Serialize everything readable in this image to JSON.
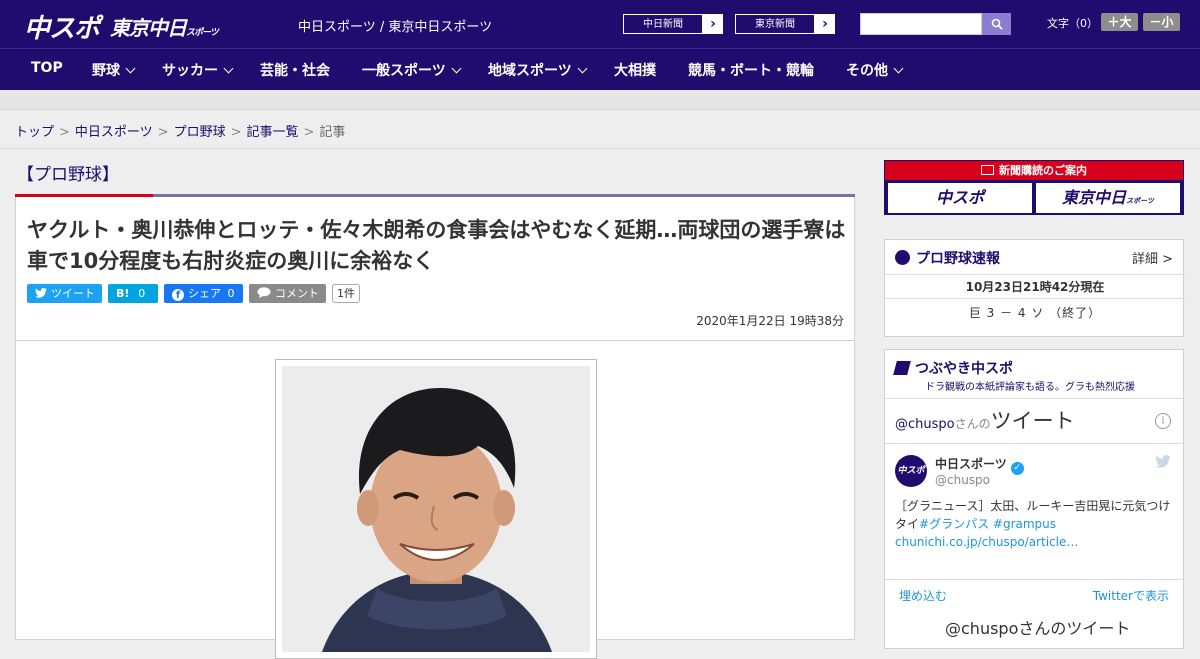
{
  "header": {
    "logo_chuspo": "中スポ",
    "logo_tokyo": "東京中日",
    "logo_tokyo_small": "スポーツ",
    "site_name": "中日スポーツ / 東京中日スポーツ",
    "paper_buttons": [
      "中日新聞",
      "東京新聞"
    ],
    "search": {
      "placeholder": ""
    },
    "font_size_label": "文字（0）",
    "font_plus": "＋大",
    "font_minus": "－小"
  },
  "nav": {
    "items": [
      {
        "label": "TOP",
        "has_dropdown": false
      },
      {
        "label": "野球",
        "has_dropdown": true
      },
      {
        "label": "サッカー",
        "has_dropdown": true
      },
      {
        "label": "芸能・社会",
        "has_dropdown": false
      },
      {
        "label": "一般スポーツ",
        "has_dropdown": true
      },
      {
        "label": "地域スポーツ",
        "has_dropdown": true
      },
      {
        "label": "大相撲",
        "has_dropdown": false
      },
      {
        "label": "競馬・ボート・競輪",
        "has_dropdown": false
      },
      {
        "label": "その他",
        "has_dropdown": true
      }
    ]
  },
  "breadcrumb": {
    "items": [
      "トップ",
      "中日スポーツ",
      "プロ野球",
      "記事一覧"
    ],
    "current": "記事",
    "separator": ">"
  },
  "article": {
    "category": "【プロ野球】",
    "headline": "ヤクルト・奥川恭伸とロッテ・佐々木朗希の食事会はやむなく延期…両球団の選手寮は車で10分程度も右肘炎症の奥川に余裕なく",
    "share": {
      "tweet": "ツイート",
      "hatena_icon": "B!",
      "hatena_count": "0",
      "facebook": "シェア",
      "facebook_count": "0",
      "comment": "コメント",
      "comment_count": "1件"
    },
    "date": "2020年1月22日 19時38分"
  },
  "sidebar": {
    "subscribe": {
      "title": "新聞購読のご案内",
      "papers": [
        "中スポ",
        "東京中日"
      ],
      "tokyo_small": "スポーツ"
    },
    "baseball": {
      "title": "プロ野球速報",
      "detail": "詳細 >",
      "updated": "10月23日21時42分現在",
      "score": "巨 3 － 4 ソ （終了）"
    },
    "tsubuyaki": {
      "title": "つぶやき中スポ",
      "subtitle": "ドラ観戦の本紙評論家も語る。グラも熱烈応援",
      "handle": "@chuspo",
      "handle_suffix": "さんの",
      "tweets_word": "ツイート",
      "info_icon": "i",
      "account_name": "中日スポーツ",
      "account_id": "@chuspo",
      "avatar_text": "中スポ",
      "tweet_text_1": "［グラニュース］太田、ルーキー吉田晃に元気つけ",
      "tweet_text_2": "タイ",
      "tweet_hashtag_1": "#グランパス",
      "tweet_hashtag_2": "#grampus",
      "tweet_link": "chunichi.co.jp/chuspo/article…",
      "embed": "埋め込む",
      "view_on_twitter": "Twitterで表示",
      "next_heading": "@chuspoさんのツイート"
    }
  },
  "colors": {
    "brand_navy": "#1f0c6e",
    "accent_red": "#d6001c",
    "twitter_blue": "#1da1f2"
  }
}
